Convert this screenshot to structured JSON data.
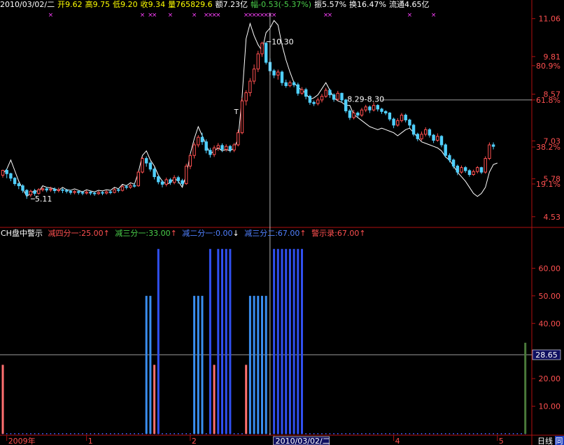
{
  "colors": {
    "background": "#000000",
    "frame": "#b01010",
    "up": "#ff5050",
    "down": "#50d0ff",
    "line": "#ffffff",
    "yellow": "#ffff00",
    "magenta": "#ff40ff",
    "green": "#4ad04a",
    "orange": "#ff8c00"
  },
  "header": {
    "date": "2010/03/02/二",
    "open": "开9.62",
    "high": "高9.75",
    "low": "低9.20",
    "close": "收9.34",
    "volume": "量765829.6",
    "amount": "额7.23亿",
    "change": "幅-0.53(-5.37%)",
    "amplitude": "振5.57%",
    "turnover": "换16.47%",
    "float": "流通4.65亿"
  },
  "price_axis": {
    "ticks": [
      {
        "label": "11.06",
        "value": 11.06
      },
      {
        "label": "9.81",
        "value": 9.81
      },
      {
        "label": "80.9%",
        "value": 9.51
      },
      {
        "label": "8.57",
        "value": 8.57
      },
      {
        "label": "61.8%",
        "value": 8.38
      },
      {
        "label": "7.03",
        "value": 7.03
      },
      {
        "label": "38.2%",
        "value": 6.83
      },
      {
        "label": "5.78",
        "value": 5.78
      },
      {
        "label": "19.1%",
        "value": 5.61
      },
      {
        "label": "4.53",
        "value": 4.53
      }
    ],
    "range": [
      4.34,
      11.26
    ],
    "fib_line_value": 8.38
  },
  "price_annotations": {
    "high_label": "10.30",
    "low_label": "5.11",
    "range_label": "8.29-8.30",
    "t_marker": "T"
  },
  "indicator": {
    "title": "CH盘中警示",
    "items": [
      {
        "label": "减四分一:25.00",
        "color": "#ff5050",
        "arrow": "↑",
        "arrow_color": "#ff5050"
      },
      {
        "label": "减三分一:33.00",
        "color": "#4ad04a",
        "arrow": "↑",
        "arrow_color": "#ff5050"
      },
      {
        "label": "减二分一:0.00",
        "color": "#5080ff",
        "arrow": "↓",
        "arrow_color": "#ffffff"
      },
      {
        "label": "减三分二:67.00",
        "color": "#5080ff",
        "arrow": "↑",
        "arrow_color": "#ff5050"
      },
      {
        "label": "警示录:67.00",
        "color": "#ff5050",
        "arrow": "↑",
        "arrow_color": "#ff5050"
      }
    ],
    "axis": {
      "ticks": [
        {
          "label": "60.00",
          "value": 60
        },
        {
          "label": "50.00",
          "value": 50
        },
        {
          "label": "40.00",
          "value": 40
        },
        {
          "label": "20.00",
          "value": 20
        },
        {
          "label": "10.00",
          "value": 10
        }
      ],
      "range": [
        0,
        71
      ],
      "current_label": "28.65",
      "current_value": 28.65
    }
  },
  "time_axis": {
    "labels": [
      {
        "label": "2009年",
        "index": 1
      },
      {
        "label": "1",
        "index": 21
      },
      {
        "label": "2",
        "index": 47
      },
      {
        "label": "2010/03/02/二",
        "index": 68
      },
      {
        "label": "4",
        "index": 98
      },
      {
        "label": "5",
        "index": 124
      }
    ],
    "corner": "日线",
    "corner2": "同"
  },
  "chart_data": {
    "type": "candlestick",
    "cursor_index": 67,
    "candles": [
      [
        5.9,
        6.06,
        5.82,
        6.08
      ],
      [
        6.06,
        5.95,
        5.8,
        6.12
      ],
      [
        5.95,
        5.8,
        5.7,
        5.98
      ],
      [
        5.8,
        5.62,
        5.55,
        5.84
      ],
      [
        5.62,
        5.55,
        5.44,
        5.66
      ],
      [
        5.55,
        5.4,
        5.32,
        5.6
      ],
      [
        5.4,
        5.25,
        5.12,
        5.44
      ],
      [
        5.25,
        5.37,
        5.18,
        5.42
      ],
      [
        5.37,
        5.3,
        5.22,
        5.45
      ],
      [
        5.3,
        5.42,
        5.26,
        5.47
      ],
      [
        5.42,
        5.45,
        5.36,
        5.5
      ],
      [
        5.45,
        5.41,
        5.34,
        5.51
      ],
      [
        5.41,
        5.44,
        5.35,
        5.52
      ],
      [
        5.44,
        5.39,
        5.3,
        5.5
      ],
      [
        5.39,
        5.42,
        5.33,
        5.49
      ],
      [
        5.42,
        5.4,
        5.31,
        5.47
      ],
      [
        5.4,
        5.37,
        5.3,
        5.45
      ],
      [
        5.37,
        5.33,
        5.26,
        5.42
      ],
      [
        5.33,
        5.36,
        5.27,
        5.41
      ],
      [
        5.36,
        5.33,
        5.26,
        5.4
      ],
      [
        5.33,
        5.31,
        5.24,
        5.38
      ],
      [
        5.31,
        5.34,
        5.26,
        5.4
      ],
      [
        5.34,
        5.31,
        5.24,
        5.38
      ],
      [
        5.31,
        5.29,
        5.22,
        5.36
      ],
      [
        5.29,
        5.33,
        5.25,
        5.38
      ],
      [
        5.33,
        5.31,
        5.24,
        5.37
      ],
      [
        5.31,
        5.35,
        5.26,
        5.4
      ],
      [
        5.35,
        5.33,
        5.27,
        5.41
      ],
      [
        5.33,
        5.42,
        5.3,
        5.48
      ],
      [
        5.42,
        5.4,
        5.33,
        5.47
      ],
      [
        5.4,
        5.52,
        5.36,
        5.57
      ],
      [
        5.52,
        5.5,
        5.43,
        5.58
      ],
      [
        5.5,
        5.56,
        5.45,
        5.62
      ],
      [
        5.56,
        5.55,
        5.49,
        5.63
      ],
      [
        5.55,
        6.0,
        5.52,
        6.05
      ],
      [
        6.0,
        6.45,
        5.96,
        6.5
      ],
      [
        6.45,
        6.3,
        6.18,
        6.52
      ],
      [
        6.3,
        6.1,
        6.02,
        6.36
      ],
      [
        6.1,
        5.85,
        5.76,
        6.15
      ],
      [
        5.85,
        5.68,
        5.6,
        5.9
      ],
      [
        5.68,
        5.6,
        5.5,
        5.74
      ],
      [
        5.6,
        5.75,
        5.53,
        5.82
      ],
      [
        5.75,
        5.66,
        5.58,
        5.81
      ],
      [
        5.66,
        5.82,
        5.6,
        5.9
      ],
      [
        5.82,
        5.72,
        5.62,
        5.88
      ],
      [
        5.72,
        5.62,
        5.55,
        5.78
      ],
      [
        5.62,
        6.2,
        5.58,
        6.28
      ],
      [
        6.2,
        6.55,
        6.1,
        6.6
      ],
      [
        6.55,
        6.9,
        6.45,
        6.98
      ],
      [
        6.9,
        7.15,
        6.82,
        7.22
      ],
      [
        7.15,
        7.0,
        6.9,
        7.3
      ],
      [
        7.0,
        6.72,
        6.62,
        7.08
      ],
      [
        6.72,
        6.58,
        6.48,
        6.8
      ],
      [
        6.58,
        6.8,
        6.5,
        6.88
      ],
      [
        6.8,
        6.88,
        6.7,
        6.96
      ],
      [
        6.88,
        6.75,
        6.66,
        6.95
      ],
      [
        6.75,
        6.85,
        6.68,
        6.92
      ],
      [
        6.85,
        6.73,
        6.65,
        6.9
      ],
      [
        6.73,
        6.9,
        6.66,
        6.96
      ],
      [
        6.9,
        7.3,
        6.85,
        7.4
      ],
      [
        7.3,
        8.35,
        7.25,
        8.45
      ],
      [
        8.35,
        8.62,
        8.2,
        8.7
      ],
      [
        8.62,
        9.0,
        8.5,
        9.1
      ],
      [
        9.0,
        9.4,
        8.9,
        9.55
      ],
      [
        9.4,
        9.9,
        9.3,
        10.0
      ],
      [
        9.9,
        10.25,
        9.8,
        10.3
      ],
      [
        10.25,
        9.62,
        9.55,
        10.3
      ],
      [
        9.62,
        9.34,
        9.2,
        9.75
      ],
      [
        9.34,
        9.2,
        9.1,
        9.4
      ],
      [
        9.2,
        9.3,
        9.05,
        9.38
      ],
      [
        9.3,
        8.95,
        8.85,
        9.35
      ],
      [
        8.95,
        8.85,
        8.78,
        9.05
      ],
      [
        8.85,
        8.95,
        8.8,
        9.02
      ],
      [
        8.95,
        8.88,
        8.8,
        9.0
      ],
      [
        8.88,
        8.6,
        8.52,
        8.95
      ],
      [
        8.6,
        8.72,
        8.55,
        8.8
      ],
      [
        8.72,
        8.5,
        8.4,
        8.78
      ],
      [
        8.5,
        8.3,
        8.22,
        8.55
      ],
      [
        8.3,
        8.26,
        8.18,
        8.36
      ],
      [
        8.26,
        8.38,
        8.2,
        8.46
      ],
      [
        8.38,
        8.5,
        8.3,
        8.58
      ],
      [
        8.5,
        8.7,
        8.45,
        8.78
      ],
      [
        8.7,
        8.55,
        8.45,
        8.75
      ],
      [
        8.55,
        8.4,
        8.32,
        8.6
      ],
      [
        8.4,
        8.6,
        8.35,
        8.68
      ],
      [
        8.6,
        8.38,
        8.3,
        8.62
      ],
      [
        8.38,
        8.02,
        7.95,
        8.42
      ],
      [
        8.02,
        7.8,
        7.72,
        8.08
      ],
      [
        7.8,
        7.95,
        7.74,
        8.05
      ],
      [
        7.95,
        7.88,
        7.8,
        8.0
      ],
      [
        7.88,
        8.05,
        7.82,
        8.12
      ],
      [
        8.05,
        8.15,
        7.98,
        8.22
      ],
      [
        8.15,
        8.05,
        7.95,
        8.2
      ],
      [
        8.05,
        8.2,
        8.0,
        8.3
      ],
      [
        8.2,
        8.08,
        8.0,
        8.24
      ],
      [
        8.08,
        8.0,
        7.92,
        8.12
      ],
      [
        8.0,
        7.95,
        7.88,
        8.04
      ],
      [
        7.95,
        7.75,
        7.68,
        7.98
      ],
      [
        7.75,
        7.55,
        7.45,
        7.8
      ],
      [
        7.55,
        7.7,
        7.5,
        7.78
      ],
      [
        7.7,
        7.88,
        7.64,
        7.95
      ],
      [
        7.88,
        7.72,
        7.64,
        7.93
      ],
      [
        7.72,
        7.55,
        7.46,
        7.76
      ],
      [
        7.55,
        7.25,
        7.18,
        7.6
      ],
      [
        7.25,
        7.1,
        7.02,
        7.3
      ],
      [
        7.1,
        7.25,
        7.04,
        7.34
      ],
      [
        7.25,
        7.4,
        7.18,
        7.48
      ],
      [
        7.4,
        7.22,
        7.14,
        7.45
      ],
      [
        7.22,
        7.05,
        6.96,
        7.26
      ],
      [
        7.05,
        7.18,
        7.0,
        7.28
      ],
      [
        7.18,
        6.9,
        6.82,
        7.22
      ],
      [
        6.9,
        6.55,
        6.48,
        6.95
      ],
      [
        6.55,
        6.4,
        6.32,
        6.62
      ],
      [
        6.4,
        6.2,
        6.12,
        6.45
      ],
      [
        6.2,
        6.0,
        5.9,
        6.25
      ],
      [
        6.0,
        6.15,
        5.95,
        6.22
      ],
      [
        6.15,
        6.05,
        5.98,
        6.2
      ],
      [
        6.05,
        5.92,
        5.85,
        6.1
      ],
      [
        5.92,
        6.02,
        5.88,
        6.08
      ],
      [
        6.02,
        6.15,
        5.96,
        6.2
      ],
      [
        6.15,
        6.0,
        5.94,
        6.18
      ],
      [
        6.0,
        6.45,
        5.95,
        6.52
      ],
      [
        6.45,
        6.9,
        6.4,
        6.98
      ],
      [
        6.9,
        6.85,
        6.75,
        6.98
      ]
    ],
    "line": [
      5.95,
      6.1,
      6.4,
      6.05,
      5.7,
      5.45,
      5.2,
      5.3,
      5.4,
      5.35,
      5.55,
      5.5,
      5.48,
      5.45,
      5.4,
      5.5,
      5.42,
      5.4,
      5.45,
      5.4,
      5.35,
      5.42,
      5.38,
      5.35,
      5.4,
      5.38,
      5.42,
      5.4,
      5.5,
      5.45,
      5.6,
      5.55,
      5.65,
      5.6,
      6.0,
      6.55,
      6.7,
      6.4,
      6.2,
      5.9,
      5.7,
      5.6,
      5.65,
      5.8,
      5.7,
      5.5,
      5.9,
      6.6,
      7.1,
      7.5,
      7.2,
      6.9,
      6.6,
      6.7,
      6.8,
      6.7,
      6.75,
      6.7,
      6.8,
      7.1,
      8.5,
      10.4,
      10.9,
      10.5,
      10.2,
      10.0,
      10.6,
      10.75,
      11.0,
      10.85,
      10.2,
      9.7,
      9.3,
      8.95,
      8.8,
      8.7,
      8.6,
      8.4,
      8.45,
      8.55,
      8.75,
      8.95,
      8.7,
      8.45,
      8.35,
      8.3,
      8.2,
      8.2,
      7.9,
      7.8,
      7.7,
      7.6,
      7.5,
      7.45,
      7.4,
      7.45,
      7.4,
      7.35,
      7.3,
      7.2,
      7.3,
      7.4,
      7.45,
      7.3,
      7.15,
      7.0,
      6.95,
      6.9,
      6.85,
      6.8,
      6.7,
      6.5,
      6.4,
      6.2,
      6.0,
      5.85,
      5.7,
      5.5,
      5.3,
      5.2,
      5.3,
      5.5,
      6.0,
      6.25,
      6.3
    ],
    "indicator_bars": [
      {
        "index": 0,
        "value": 25,
        "color": "#ff7070"
      },
      {
        "index": 36,
        "value": 50,
        "color": "#3a8ef0"
      },
      {
        "index": 37,
        "value": 50,
        "color": "#3a8ef0"
      },
      {
        "index": 38,
        "value": 25,
        "color": "#ff7070"
      },
      {
        "index": 39,
        "value": 67,
        "color": "#3050f0"
      },
      {
        "index": 48,
        "value": 50,
        "color": "#3a8ef0"
      },
      {
        "index": 49,
        "value": 50,
        "color": "#3a8ef0"
      },
      {
        "index": 50,
        "value": 50,
        "color": "#3a8ef0"
      },
      {
        "index": 52,
        "value": 67,
        "color": "#3050f0"
      },
      {
        "index": 53,
        "value": 25,
        "color": "#ff7070"
      },
      {
        "index": 54,
        "value": 67,
        "color": "#3050f0"
      },
      {
        "index": 55,
        "value": 67,
        "color": "#3050f0"
      },
      {
        "index": 56,
        "value": 67,
        "color": "#3050f0"
      },
      {
        "index": 57,
        "value": 67,
        "color": "#3050f0"
      },
      {
        "index": 61,
        "value": 25,
        "color": "#ff7070"
      },
      {
        "index": 62,
        "value": 50,
        "color": "#3a8ef0"
      },
      {
        "index": 63,
        "value": 50,
        "color": "#3a8ef0"
      },
      {
        "index": 64,
        "value": 50,
        "color": "#3a8ef0"
      },
      {
        "index": 65,
        "value": 50,
        "color": "#3a8ef0"
      },
      {
        "index": 66,
        "value": 50,
        "color": "#3a8ef0"
      },
      {
        "index": 68,
        "value": 67,
        "color": "#3050f0"
      },
      {
        "index": 69,
        "value": 67,
        "color": "#3050f0"
      },
      {
        "index": 70,
        "value": 67,
        "color": "#3050f0"
      },
      {
        "index": 71,
        "value": 67,
        "color": "#3050f0"
      },
      {
        "index": 72,
        "value": 67,
        "color": "#3050f0"
      },
      {
        "index": 73,
        "value": 67,
        "color": "#3050f0"
      },
      {
        "index": 74,
        "value": 67,
        "color": "#3050f0"
      },
      {
        "index": 75,
        "value": 67,
        "color": "#3050f0"
      },
      {
        "index": 131,
        "value": 33,
        "color": "#4a7a3a"
      }
    ],
    "signal_markers": [
      12,
      35,
      37,
      38,
      42,
      48,
      51,
      52,
      53,
      54,
      61,
      62,
      63,
      64,
      65,
      66,
      67,
      68,
      81,
      82,
      102,
      108
    ]
  }
}
